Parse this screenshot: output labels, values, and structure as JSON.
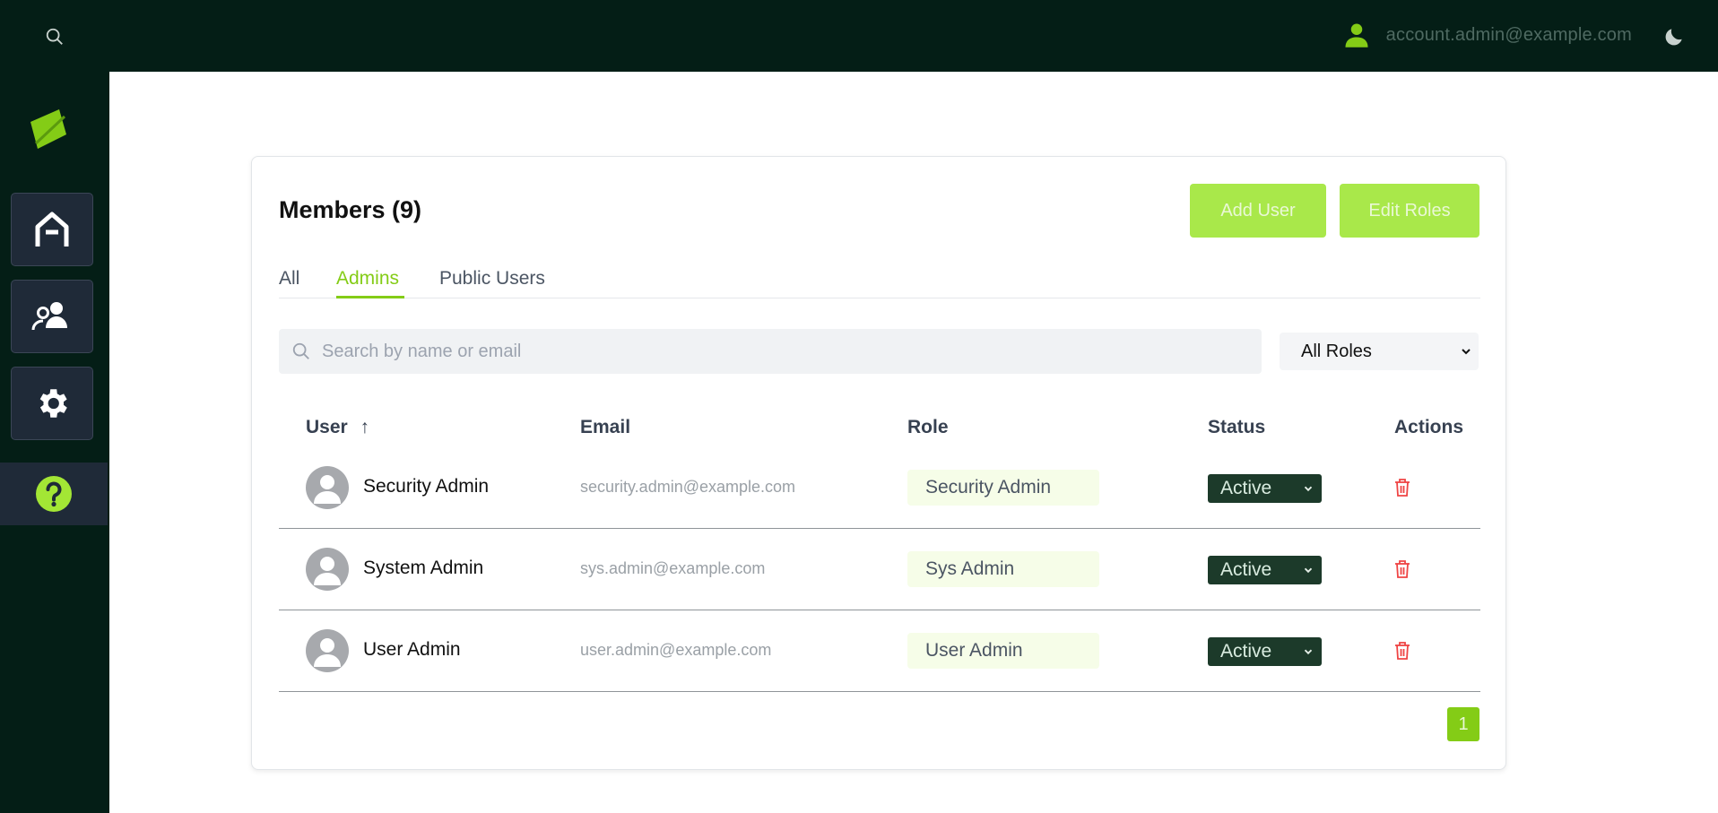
{
  "header": {
    "account_email": "account.admin@example.com",
    "search_icon": "search-icon",
    "user_icon": "user-icon",
    "theme_icon": "moon-icon"
  },
  "sidebar": {
    "logo_icon": "leaf-logo-icon",
    "items": [
      {
        "icon": "home-icon"
      },
      {
        "icon": "users-icon"
      },
      {
        "icon": "gear-icon"
      },
      {
        "icon": "help-icon"
      }
    ]
  },
  "members": {
    "title": "Members (9)",
    "add_user_label": "Add User",
    "edit_roles_label": "Edit Roles",
    "tabs": [
      {
        "label": "All"
      },
      {
        "label": "Admins"
      },
      {
        "label": "Public Users"
      }
    ],
    "active_tab": "Admins",
    "search": {
      "placeholder": "Search by name or email",
      "value": ""
    },
    "role_filter": {
      "selected": "All Roles"
    },
    "columns": {
      "user": "User",
      "sort_indicator": "↑",
      "email": "Email",
      "role": "Role",
      "status": "Status",
      "actions": "Actions"
    },
    "rows": [
      {
        "name": "Security Admin",
        "email": "security.admin@example.com",
        "role": "Security Admin",
        "status": "Active"
      },
      {
        "name": "System Admin",
        "email": "sys.admin@example.com",
        "role": "Sys Admin",
        "status": "Active"
      },
      {
        "name": "User Admin",
        "email": "user.admin@example.com",
        "role": "User Admin",
        "status": "Active"
      }
    ],
    "pagination": {
      "current_page": "1"
    }
  },
  "colors": {
    "nav_background": "#041e16",
    "accent": "#84cc16",
    "button": "#a9e84a",
    "status_background": "#1c3a2a",
    "delete": "#ef4444"
  }
}
